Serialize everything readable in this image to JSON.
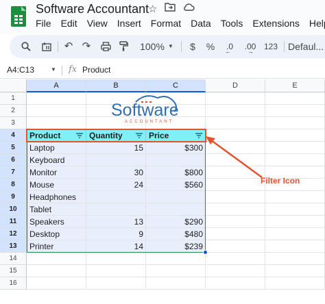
{
  "app": {
    "title": "Software Accountant"
  },
  "menu": [
    "File",
    "Edit",
    "View",
    "Insert",
    "Format",
    "Data",
    "Tools",
    "Extensions",
    "Help"
  ],
  "toolbar": {
    "zoom": "100%",
    "currency": "$",
    "percent": "%",
    "dec_decrease": ".0",
    "dec_increase": ".00",
    "number_format": "123",
    "font": "Defaul..."
  },
  "formula_bar": {
    "range": "A4:C13",
    "fx": "fx",
    "content": "Product"
  },
  "columns": [
    "A",
    "B",
    "C",
    "D",
    "E"
  ],
  "rows": [
    "1",
    "2",
    "3",
    "4",
    "5",
    "6",
    "7",
    "8",
    "9",
    "10",
    "11",
    "12",
    "13",
    "14",
    "15",
    "16"
  ],
  "table": {
    "headers": [
      "Product",
      "Quantity",
      "Price"
    ],
    "rows": [
      [
        "Laptop",
        "15",
        "$300"
      ],
      [
        "Keyboard",
        "",
        ""
      ],
      [
        "Monitor",
        "30",
        "$800"
      ],
      [
        "Mouse",
        "24",
        "$560"
      ],
      [
        "Headphones",
        "",
        ""
      ],
      [
        "Tablet",
        "",
        ""
      ],
      [
        "Speakers",
        "13",
        "$290"
      ],
      [
        "Desktop",
        "9",
        "$480"
      ],
      [
        "Printer",
        "14",
        "$239"
      ]
    ]
  },
  "logo": {
    "line1": "Software",
    "line2": "ACCOUNTANT"
  },
  "annotation": {
    "label": "Filter Icon",
    "color": "#e0532e"
  },
  "colors": {
    "header_fill": "#7ff0f8",
    "selection": "#e8eefb",
    "accent": "#0b57d0"
  }
}
